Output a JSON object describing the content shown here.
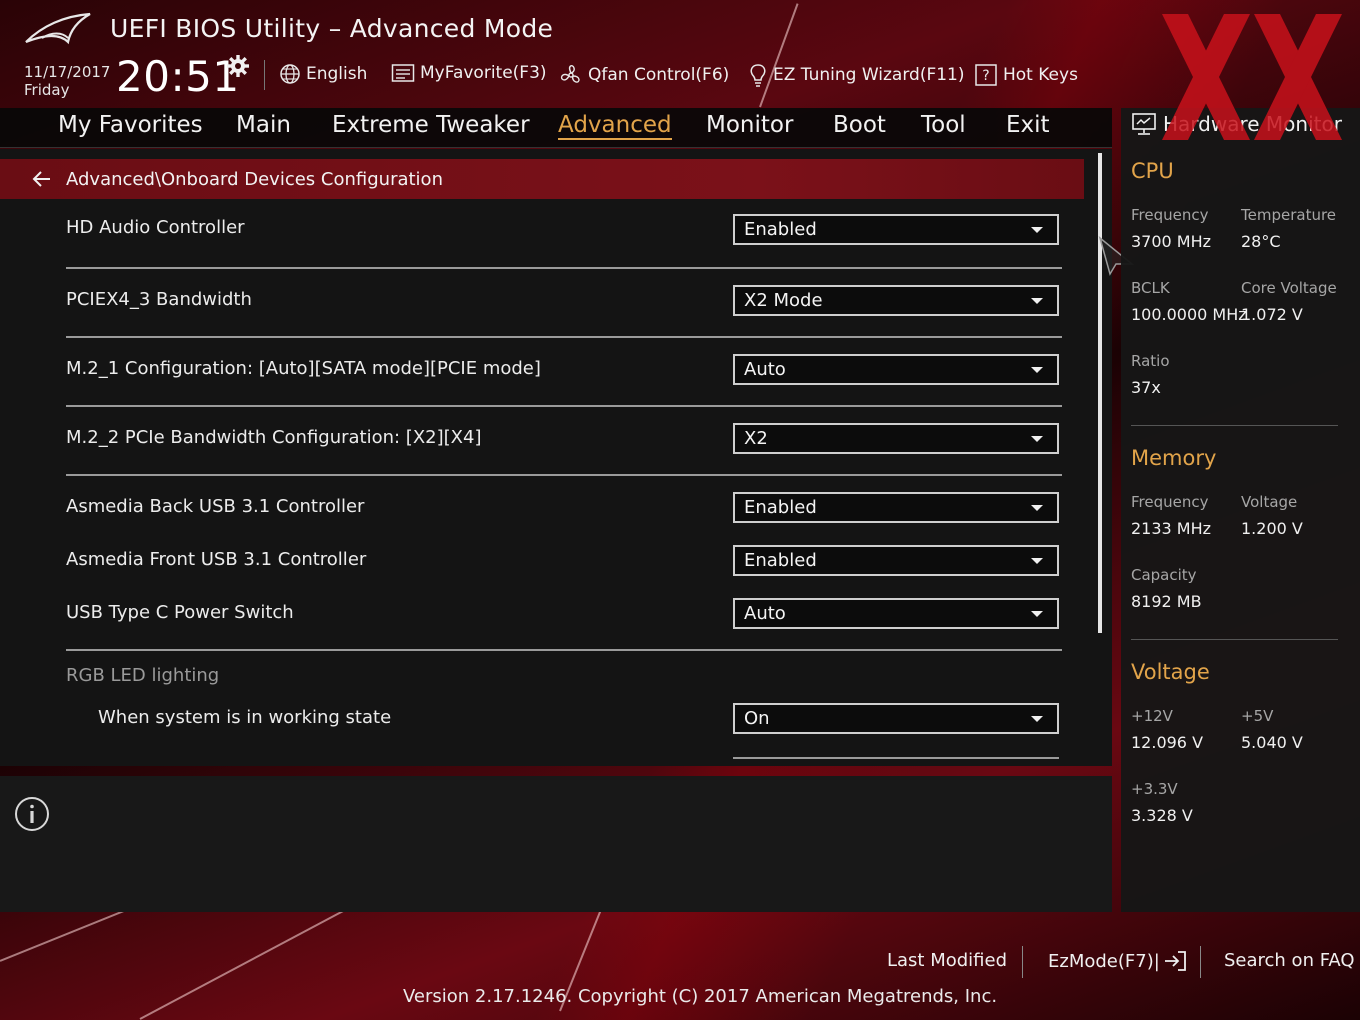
{
  "header": {
    "app_title": "UEFI BIOS Utility – Advanced Mode",
    "date": "11/17/2017",
    "weekday": "Friday",
    "time": "20:51",
    "toolbar": {
      "language": "English",
      "my_favorite": "MyFavorite(F3)",
      "qfan": "Qfan Control(F6)",
      "ez_tuning": "EZ Tuning Wizard(F11)",
      "hot_keys": "Hot Keys"
    },
    "icons": [
      "rog-logo",
      "gear-icon",
      "globe-icon",
      "favorite-list-icon",
      "fan-icon",
      "lightbulb-icon",
      "question-icon"
    ]
  },
  "nav": {
    "tabs": [
      "My Favorites",
      "Main",
      "Extreme Tweaker",
      "Advanced",
      "Monitor",
      "Boot",
      "Tool",
      "Exit"
    ],
    "active": "Advanced",
    "active_color": "#e2a44a"
  },
  "main": {
    "breadcrumb": "Advanced\\Onboard Devices Configuration",
    "settings": [
      {
        "label": "HD Audio Controller",
        "value": "Enabled"
      },
      {
        "label": "PCIEX4_3 Bandwidth",
        "value": "X2 Mode"
      },
      {
        "label": "M.2_1 Configuration: [Auto][SATA mode][PCIE mode]",
        "value": "Auto"
      },
      {
        "label": "M.2_2 PCIe Bandwidth Configuration: [X2][X4]",
        "value": "X2"
      },
      {
        "label": "Asmedia Back USB 3.1 Controller",
        "value": "Enabled"
      },
      {
        "label": "Asmedia Front USB 3.1 Controller",
        "value": "Enabled"
      },
      {
        "label": "USB Type C Power Switch",
        "value": "Auto"
      }
    ],
    "group_label": "RGB LED lighting",
    "sub_setting": {
      "label": "When system is in working state",
      "value": "On"
    }
  },
  "hardware_monitor": {
    "title": "Hardware Monitor",
    "cpu": {
      "section": "CPU",
      "frequency_label": "Frequency",
      "frequency": "3700 MHz",
      "temperature_label": "Temperature",
      "temperature": "28°C",
      "bclk_label": "BCLK",
      "bclk": "100.0000 MHz",
      "core_voltage_label": "Core Voltage",
      "core_voltage": "1.072 V",
      "ratio_label": "Ratio",
      "ratio": "37x"
    },
    "memory": {
      "section": "Memory",
      "frequency_label": "Frequency",
      "frequency": "2133 MHz",
      "voltage_label": "Voltage",
      "voltage": "1.200 V",
      "capacity_label": "Capacity",
      "capacity": "8192 MB"
    },
    "voltage": {
      "section": "Voltage",
      "v12_label": "+12V",
      "v12": "12.096 V",
      "v5_label": "+5V",
      "v5": "5.040 V",
      "v33_label": "+3.3V",
      "v33": "3.328 V"
    }
  },
  "footer": {
    "last_modified": "Last Modified",
    "ez_mode": "EzMode(F7)|",
    "search_faq": "Search on FAQ",
    "version": "Version 2.17.1246. Copyright (C) 2017 American Megatrends, Inc."
  },
  "colors": {
    "accent": "#e2a44a",
    "breadcrumb_bg": "#7b1119",
    "watermark": "#c8111b"
  }
}
